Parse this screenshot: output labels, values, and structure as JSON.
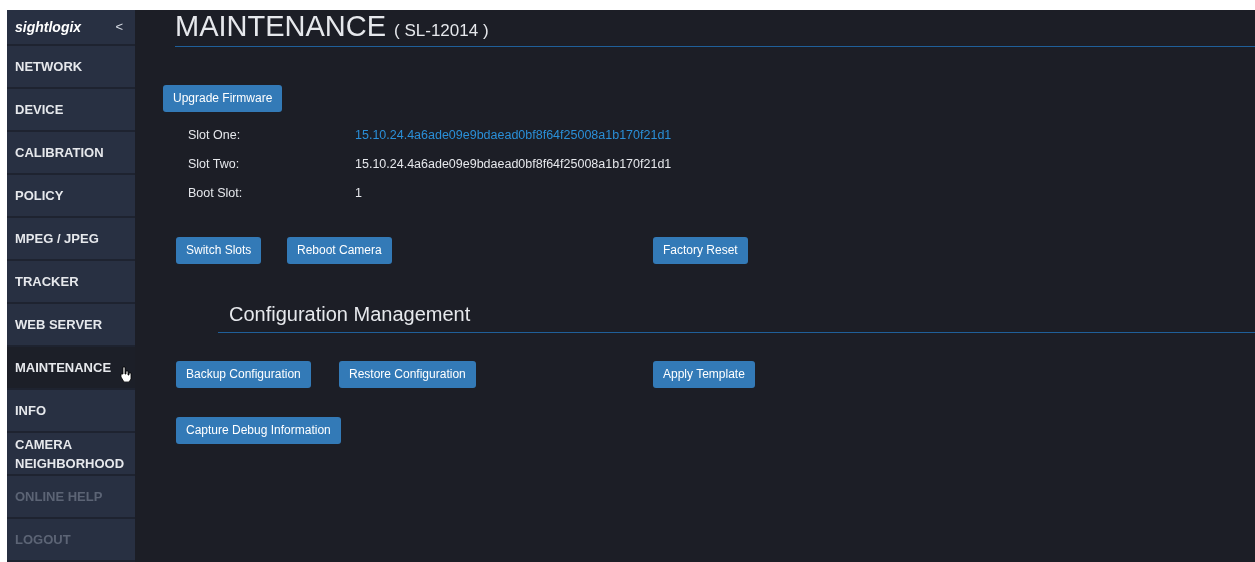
{
  "sidebar": {
    "logo": "sightlogix",
    "collapse": "<",
    "items": [
      {
        "label": "NETWORK",
        "selected": false,
        "disabled": false
      },
      {
        "label": "DEVICE",
        "selected": false,
        "disabled": false
      },
      {
        "label": "CALIBRATION",
        "selected": false,
        "disabled": false
      },
      {
        "label": "POLICY",
        "selected": false,
        "disabled": false
      },
      {
        "label": "MPEG / JPEG",
        "selected": false,
        "disabled": false
      },
      {
        "label": "TRACKER",
        "selected": false,
        "disabled": false
      },
      {
        "label": "WEB SERVER",
        "selected": false,
        "disabled": false
      },
      {
        "label": "MAINTENANCE",
        "selected": true,
        "disabled": false
      },
      {
        "label": "INFO",
        "selected": false,
        "disabled": false
      },
      {
        "label": "CAMERA NEIGHBORHOOD",
        "selected": false,
        "disabled": false
      },
      {
        "label": "ONLINE HELP",
        "selected": false,
        "disabled": true
      },
      {
        "label": "LOGOUT",
        "selected": false,
        "disabled": true
      }
    ]
  },
  "page": {
    "title": "MAINTENANCE",
    "subtitle": "( SL-12014 )"
  },
  "firmware": {
    "button": "Upgrade Firmware",
    "rows": [
      {
        "label": "Slot One:",
        "value": "15.10.24.4a6ade09e9bdaead0bf8f64f25008a1b170f21d1",
        "kind": "link"
      },
      {
        "label": "Slot Two:",
        "value": "15.10.24.4a6ade09e9bdaead0bf8f64f25008a1b170f21d1",
        "kind": "text"
      },
      {
        "label": "Boot Slot:",
        "value": "1",
        "kind": "text"
      }
    ],
    "buttons": [
      "Switch Slots",
      "Reboot Camera",
      "Factory Reset"
    ]
  },
  "configuration": {
    "title": "Configuration Management",
    "buttons": [
      "Backup Configuration",
      "Restore Configuration",
      "Apply Template"
    ],
    "debug_button": "Capture Debug Information"
  }
}
